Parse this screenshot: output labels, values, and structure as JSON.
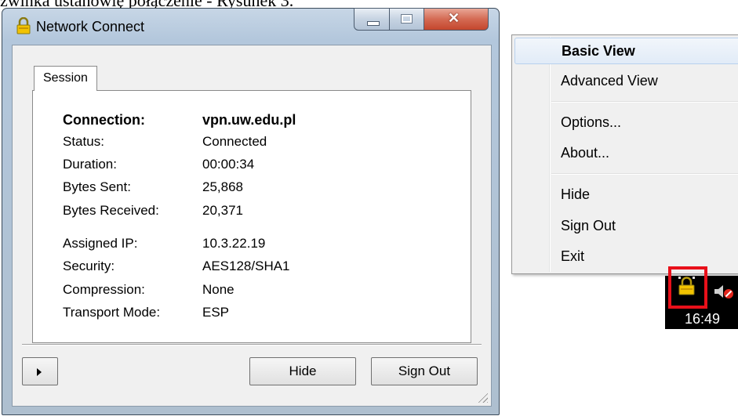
{
  "caption": "zwinka ustanowię połączenie - Rysunek 3.",
  "window": {
    "title": "Network Connect",
    "tab": "Session",
    "rows": [
      {
        "label": "Connection:",
        "value": "vpn.uw.edu.pl"
      },
      {
        "label": "Status:",
        "value": "Connected"
      },
      {
        "label": "Duration:",
        "value": "00:00:34"
      },
      {
        "label": "Bytes Sent:",
        "value": "25,868"
      },
      {
        "label": "Bytes Received:",
        "value": "20,371"
      },
      {
        "label": "Assigned IP:",
        "value": "10.3.22.19"
      },
      {
        "label": "Security:",
        "value": "AES128/SHA1"
      },
      {
        "label": "Compression:",
        "value": "None"
      },
      {
        "label": "Transport Mode:",
        "value": "ESP"
      }
    ],
    "buttons": {
      "hide": "Hide",
      "sign_out": "Sign Out"
    }
  },
  "menu": {
    "items": [
      {
        "label": "Basic View"
      },
      {
        "label": "Advanced View"
      },
      {
        "label": "Options..."
      },
      {
        "label": "About..."
      },
      {
        "label": "Hide"
      },
      {
        "label": "Sign Out"
      },
      {
        "label": "Exit"
      }
    ]
  },
  "tray": {
    "clock": "16:49"
  },
  "icons": {
    "app": "padlock-icon",
    "tray": "vpn-padlock-icon",
    "speaker": "speaker-muted-icon"
  },
  "colors": {
    "highlight": "#e8101a",
    "tray_bg": "#000000"
  }
}
